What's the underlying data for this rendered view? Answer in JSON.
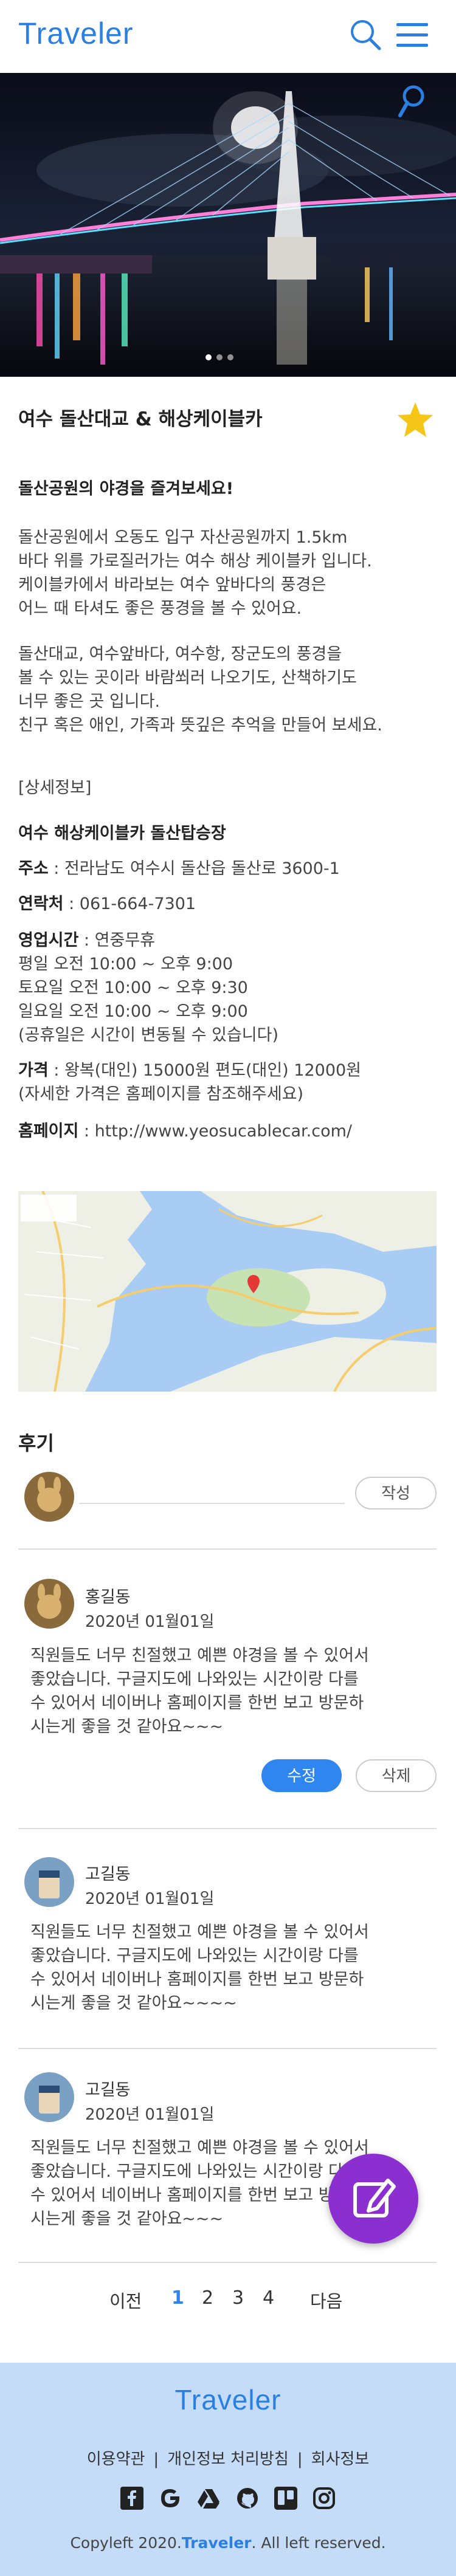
{
  "header": {
    "logo": "Traveler",
    "search_icon": "search-icon",
    "menu_icon": "hamburger-menu-icon"
  },
  "hero": {
    "search_icon": "search-icon",
    "slide_count": 3,
    "active_slide": 1
  },
  "place": {
    "title": "여수 돌산대교 & 해상케이블카",
    "favorite_icon": "star-icon",
    "favorite_color": "#f5c518"
  },
  "intro": {
    "heading": "돌산공원의 야경을 즐겨보세요!",
    "p1": [
      "돌산공원에서 오동도 입구 자산공원까지 1.5km",
      "바다 위를 가로질러가는 여수 해상 케이블카 입니다.",
      "케이블카에서 바라보는 여수 앞바다의 풍경은",
      "어느 때 타셔도 좋은 풍경을 볼 수 있어요."
    ],
    "p2": [
      "돌산대교, 여수앞바다, 여수항, 장군도의 풍경을",
      "볼 수 있는 곳이라 바람쐬러 나오기도, 산책하기도",
      "너무 좋은 곳 입니다.",
      "친구 혹은 애인, 가족과 뜻깊은 추억을 만들어 보세요."
    ]
  },
  "details": {
    "section_label": "[상세정보]",
    "name": "여수 해상케이블카 돌산탑승장",
    "address_label": "주소",
    "address": " : 전라남도 여수시 돌산읍 돌산로 3600-1",
    "phone_label": "연락처",
    "phone": " : 061-664-7301",
    "hours_label": "영업시간",
    "hours_first": " : 연중무휴",
    "hours_lines": [
      "평일 오전 10:00 ~ 오후 9:00",
      "토요일 오전 10:00 ~ 오후 9:30",
      "일요일 오전 10:00 ~ 오후 9:00",
      "(공휴일은 시간이 변동될 수 있습니다)"
    ],
    "price_label": "가격",
    "price": " : 왕복(대인) 15000원 편도(대인) 12000원",
    "price_note": "(자세한 가격은 홈페이지를 참조해주세요)",
    "homepage_label": "홈페이지",
    "homepage": " : http://www.yeosucablecar.com/"
  },
  "reviews": {
    "heading": "후기",
    "write_button": "작성",
    "input_placeholder": "",
    "items": [
      {
        "author": "홍길동",
        "date": "2020년 01월01일",
        "body": [
          "직원들도 너무 친절했고 예쁜 야경을 볼 수 있어서",
          "좋았습니다. 구글지도에 나와있는 시간이랑 다를",
          "수 있어서 네이버나 홈페이지를 한번 보고 방문하",
          "시는게 좋을 것 같아요~~~"
        ],
        "edit": "수정",
        "delete": "삭제"
      },
      {
        "author": "고길동",
        "date": "2020년 01월01일",
        "body": [
          "직원들도 너무 친절했고 예쁜 야경을 볼 수 있어서",
          "좋았습니다. 구글지도에 나와있는 시간이랑 다를",
          "수 있어서 네이버나 홈페이지를 한번 보고 방문하",
          "시는게 좋을 것 같아요~~~~"
        ]
      },
      {
        "author": "고길동",
        "date": "2020년 01월01일",
        "body": [
          "직원들도 너무 친절했고 예쁜 야경을 볼 수 있어서",
          "좋았습니다. 구글지도에 나와있는 시간이랑 다를",
          "수 있어서 네이버나 홈페이지를 한번 보고 방문하",
          "시는게 좋을 것 같아요~~~"
        ]
      }
    ]
  },
  "pagination": {
    "prev": "이전",
    "pages": [
      "1",
      "2",
      "3",
      "4"
    ],
    "current": "1",
    "next": "다음"
  },
  "fab": {
    "icon": "edit-icon",
    "color": "#8b2fd0"
  },
  "footer": {
    "logo": "Traveler",
    "links": [
      "이용약관",
      "개인정보 처리방침",
      "회사정보"
    ],
    "social_icons": [
      "facebook-icon",
      "google-icon",
      "google-drive-icon",
      "github-icon",
      "trello-icon",
      "instagram-icon"
    ],
    "copyright_prefix": "Copyleft 2020.",
    "copyright_brand": "Traveler",
    "copyright_suffix": ". All left reserved.",
    "background": "#c4dcf7"
  },
  "colors": {
    "brand": "#2a7fe0",
    "primary_button": "#2f86f1"
  }
}
